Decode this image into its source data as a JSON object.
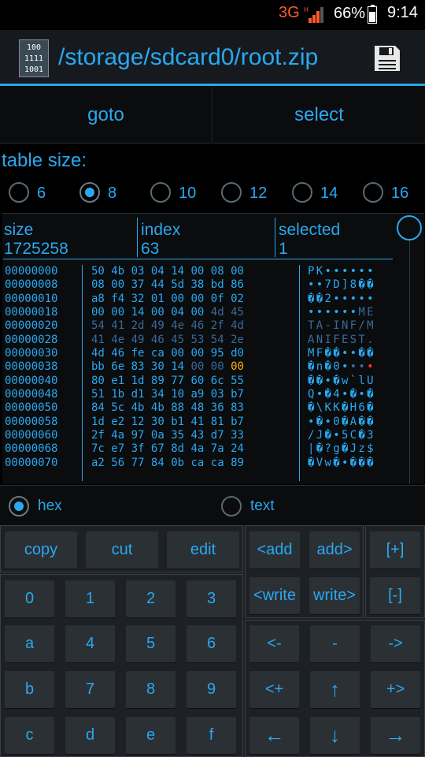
{
  "status_bar": {
    "network": "3G",
    "battery": "66%",
    "time": "9:14"
  },
  "app_bar": {
    "title": "/storage/sdcard0/root.zip",
    "app_icon_lines": [
      "100",
      "1111",
      "1001"
    ]
  },
  "toolbar": {
    "goto_label": "goto",
    "select_label": "select"
  },
  "table_size": {
    "label": "table size:",
    "options": [
      "6",
      "8",
      "10",
      "12",
      "14",
      "16"
    ],
    "selected": "8"
  },
  "info": {
    "size_label": "size",
    "size_value": "1725258",
    "index_label": "index",
    "index_value": "63",
    "selected_label": "selected",
    "selected_value": "1"
  },
  "hex_view": {
    "offsets": [
      "00000000",
      "00000008",
      "00000010",
      "00000018",
      "00000020",
      "00000028",
      "00000030",
      "00000038",
      "00000040",
      "00000048",
      "00000050",
      "00000058",
      "00000060",
      "00000068",
      "00000070"
    ],
    "bytes": [
      "50 4b 03 04 14 00 08 00",
      "08 00 37 44 5d 38 bd 86",
      "a8 f4 32 01 00 00 0f 02",
      "00 00 14 00 04 00 4d 45",
      "54 41 2d 49 4e 46 2f 4d",
      "41 4e 49 46 45 53 54 2e",
      "4d 46 fe ca 00 00 95 d0",
      "bb 6e 83 30 14 00 00 00",
      "80 e1 1d 89 77 60 6c 55",
      "51 1b d1 34 10 a9 03 b7",
      "84 5c 4b 4b 88 48 36 83",
      "1d e2 12 30 b1 41 81 b7",
      "2f 4a 97 0a 35 43 d7 33",
      "7c e7 3f 67 8d 4a 7a 24",
      "a2 56 77 84 0b ca ca 89"
    ],
    "text": [
      "PK••••••",
      "••7D]8��",
      "��2•••••",
      "••••••ME",
      "TA-INF/M",
      "ANIFEST.",
      "MF��••��",
      "�n�0••••",
      "��•�w`lU",
      "Q•�4•�•�",
      "�\\KK�H6�",
      "•�•0�A��",
      "/J�•5C�3",
      "|�?g�Jz$",
      "�Vw�•���"
    ],
    "highlight_byte": "00"
  },
  "mode": {
    "hex_label": "hex",
    "text_label": "text",
    "selected": "hex"
  },
  "keypad": {
    "actions": [
      "copy",
      "cut",
      "edit"
    ],
    "edit_ops": [
      "<add",
      "add>",
      "<write",
      "write>"
    ],
    "size_ops": [
      "[+]",
      "[-]"
    ],
    "digits": [
      [
        "0",
        "1",
        "2",
        "3"
      ],
      [
        "a",
        "4",
        "5",
        "6"
      ],
      [
        "b",
        "7",
        "8",
        "9"
      ],
      [
        "c",
        "d",
        "e",
        "f"
      ]
    ],
    "nav": [
      [
        "<-",
        "-",
        "->"
      ],
      [
        "<+",
        "↑",
        "+>"
      ],
      [
        "←",
        "↓",
        "→"
      ]
    ]
  }
}
